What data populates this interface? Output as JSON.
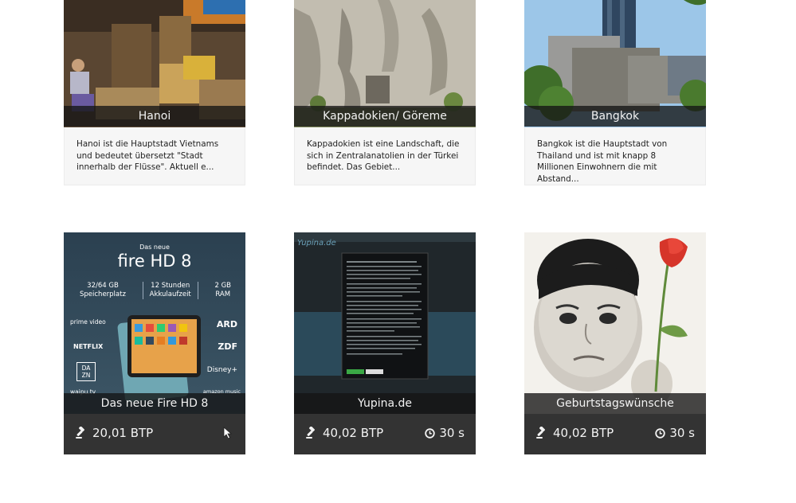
{
  "destinations": [
    {
      "title": "Hanoi",
      "text": "Hanoi ist die Hauptstadt Vietnams und bedeutet übersetzt \"Stadt innerhalb der Flüsse\". Aktuell e..."
    },
    {
      "title": "Kappadokien/ Göreme",
      "text": "Kappadokien ist eine Landschaft, die sich in Zentralanatolien in der Türkei befindet. Das Gebiet..."
    },
    {
      "title": "Bangkok",
      "text": "Bangkok ist die Hauptstadt von Thailand und ist mit knapp 8 Millionen Einwohnern die mit Abstand..."
    }
  ],
  "ads": [
    {
      "title": "Das neue Fire HD 8",
      "price": "20,01 BTP",
      "banner": {
        "kicker": "Das neue",
        "product": "fire HD 8",
        "specs": [
          {
            "value": "32/64 GB",
            "label": "Speicherplatz"
          },
          {
            "value": "12 Stunden",
            "label": "Akkulaufzeit"
          },
          {
            "value": "2 GB",
            "label": "RAM"
          }
        ],
        "left_logos": [
          "prime video",
          "NETFLIX",
          "DA ZN",
          "waipu.tv"
        ],
        "right_logos": [
          "ARD",
          "ZDF",
          "Disney+",
          "amazon music"
        ]
      }
    },
    {
      "title": "Yupina.de",
      "price": "40,02 BTP",
      "time": "30 s",
      "site_logo": "Yupina.de"
    },
    {
      "title": "Geburtstagswünsche",
      "price": "40,02 BTP",
      "time": "30 s"
    }
  ],
  "colors": {
    "caption_bg": "#141414",
    "bar_bg": "#333333",
    "desc_bg": "#f6f6f6"
  }
}
